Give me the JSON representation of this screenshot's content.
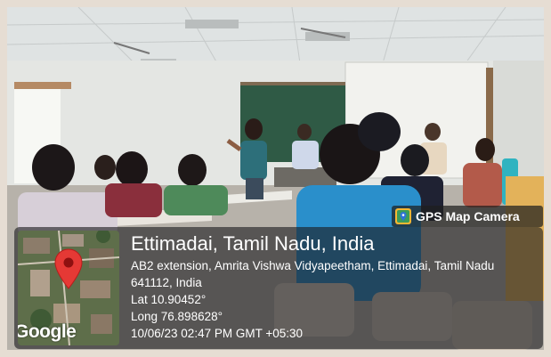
{
  "app_badge": {
    "label": "GPS Map Camera",
    "icon": "gps-map-camera-app-icon"
  },
  "location": {
    "title": "Ettimadai, Tamil Nadu, India",
    "address": "AB2 extension, Amrita Vishwa Vidyapeetham, Ettimadai, Tamil Nadu 641112, India",
    "latitude": "Lat 10.90452°",
    "longitude": "Long 76.898628°",
    "datetime": "10/06/23 02:47 PM GMT +05:30"
  },
  "map": {
    "attribution": "Google",
    "pin_icon": "map-pin-icon",
    "pin_color": "#e53935"
  },
  "colors": {
    "card_bg": "#1c1c1e",
    "text": "#ffffff",
    "frame": "#e6ddd3"
  }
}
